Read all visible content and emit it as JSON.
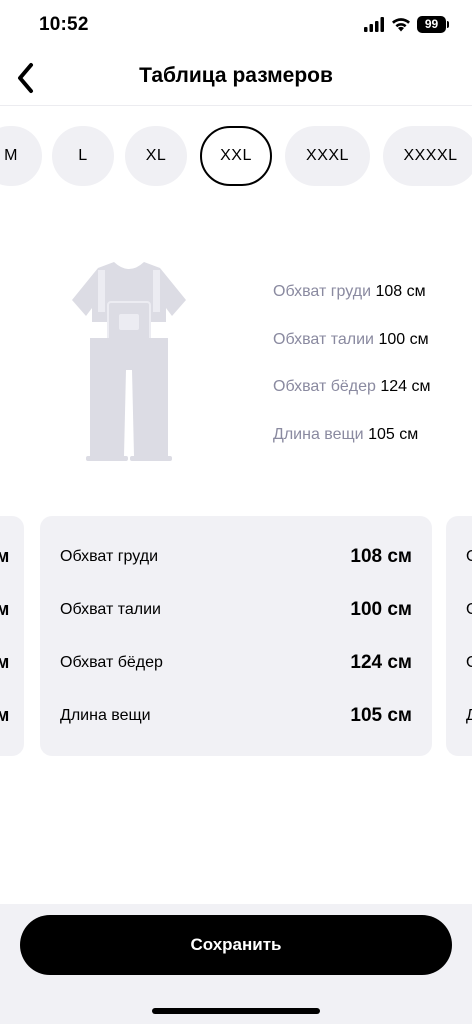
{
  "status_bar": {
    "time": "10:52",
    "battery": "99"
  },
  "nav": {
    "title": "Таблица размеров"
  },
  "sizes": {
    "items": [
      "M",
      "L",
      "XL",
      "XXL",
      "XXXL",
      "XXXXL"
    ],
    "selected": "XXL"
  },
  "measurements": [
    {
      "label": "Обхват груди",
      "value": "108 см"
    },
    {
      "label": "Обхват талии",
      "value": "100 см"
    },
    {
      "label": "Обхват бёдер",
      "value": "124 см"
    },
    {
      "label": "Длина вещи",
      "value": "105 см"
    }
  ],
  "card": {
    "rows": [
      {
        "label": "Обхват груди",
        "value": "108 см"
      },
      {
        "label": "Обхват талии",
        "value": "100 см"
      },
      {
        "label": "Обхват бёдер",
        "value": "124 см"
      },
      {
        "label": "Длина вещи",
        "value": "105 см"
      }
    ]
  },
  "peek_left": [
    "м",
    "м",
    "м",
    "м"
  ],
  "peek_right": [
    "О",
    "О",
    "О",
    "Д"
  ],
  "actions": {
    "save_label": "Сохранить"
  },
  "colors": {
    "accent": "#000000",
    "chip_bg": "#f0f0f4",
    "muted_text": "#8a8aa0",
    "illustration": "#dcdce4"
  },
  "icons": {
    "back": "chevron-left-icon",
    "illustration": "overalls-icon"
  }
}
